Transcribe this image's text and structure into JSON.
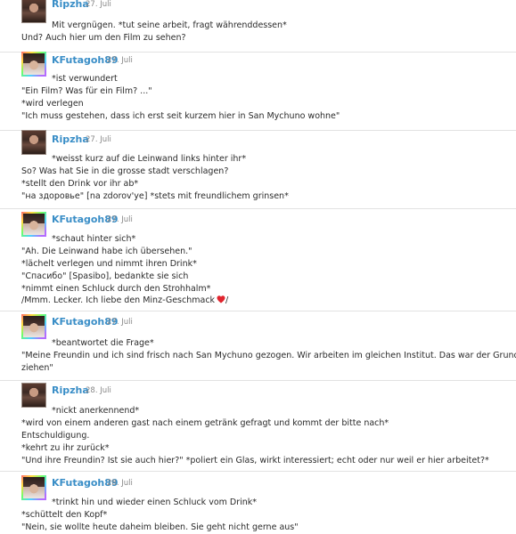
{
  "posts": [
    {
      "author": "Ripzha",
      "date": "27. Juli",
      "lines": [
        "Mit vergnügen. *tut seine arbeit, fragt währenddessen*",
        "Und? Auch hier um den Film zu sehen?"
      ]
    },
    {
      "author": "KFutagoh89",
      "date": "27. Juli",
      "lines": [
        "*ist verwundert",
        "\"Ein Film? Was für ein Film? ...\"",
        "*wird verlegen",
        "\"Ich muss gestehen, dass ich erst seit kurzem hier in San Mychuno wohne\""
      ]
    },
    {
      "author": "Ripzha",
      "date": "27. Juli",
      "lines": [
        "*weisst kurz auf die Leinwand links hinter ihr*",
        "So? Was hat Sie in die grosse stadt verschlagen?",
        "*stellt den Drink vor ihr ab*",
        "\"на здоровье\" [na zdorov'ye] *stets mit freundlichem grinsen*"
      ]
    },
    {
      "author": "KFutagoh89",
      "date": "27. Juli",
      "lines": [
        "*schaut hinter sich*",
        "\"Ah. Die Leinwand habe ich übersehen.\"",
        "*lächelt verlegen und nimmt ihren Drink*",
        "\"Спасибо\" [Spasibo], bedankte sie sich",
        "*nimmt einen Schluck durch den Strohhalm*",
        "/Mmm. Lecker. Ich liebe den Minz-Geschmack",
        "/"
      ]
    },
    {
      "author": "KFutagoh89",
      "date": "27. Juli",
      "lines": [
        "*beantwortet die Frage*",
        "\"Meine Freundin und ich sind frisch nach San Mychuno gezogen. Wir arbeiten im gleichen Institut. Das war der Grund hierher zu",
        "ziehen\""
      ]
    },
    {
      "author": "Ripzha",
      "date": "28. Juli",
      "lines": [
        "*nickt anerkennend*",
        "*wird von einem anderen gast nach einem getränk gefragt und kommt der bitte nach*",
        "Entschuldigung.",
        "*kehrt zu ihr zurück*",
        "\"Und ihre Freundin? Ist sie auch hier?\" *poliert ein Glas, wirkt interessiert; echt oder nur weil er hier arbeitet?*"
      ]
    },
    {
      "author": "KFutagoh89",
      "date": "28. Juli",
      "lines": [
        "*trinkt hin und wieder einen Schluck vom Drink*",
        "*schüttelt den Kopf*",
        "\"Nein, sie wollte heute daheim bleiben. Sie geht nicht gerne aus\""
      ]
    }
  ],
  "colors": {
    "username": "#3a8ec7",
    "date": "#888888",
    "text": "#2a2a2a",
    "divider": "#e2e2e2",
    "heart": "#e0252e"
  },
  "icons": {
    "heart": "red-heart-emoji"
  }
}
